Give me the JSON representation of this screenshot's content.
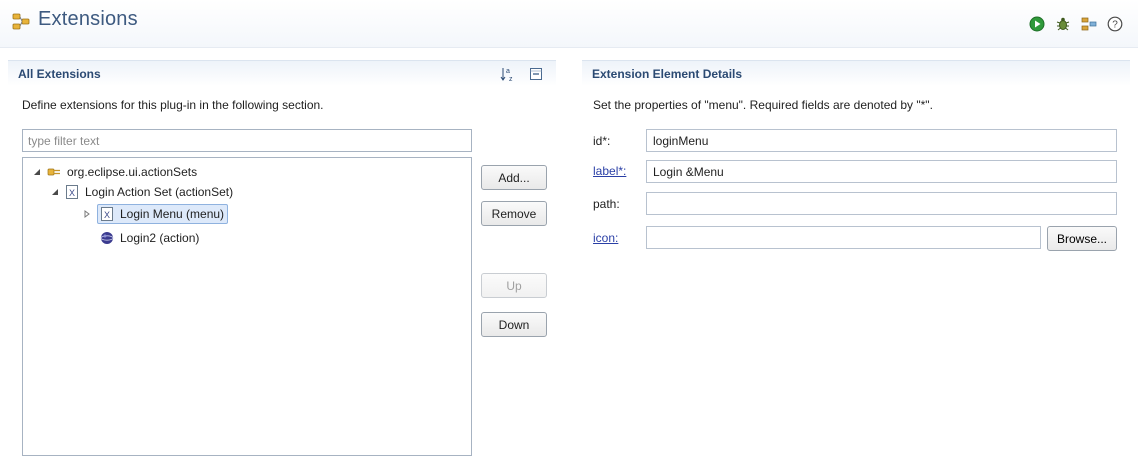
{
  "header": {
    "title": "Extensions",
    "actions": [
      "run-icon",
      "debug-icon",
      "plugin-icon",
      "help-icon"
    ]
  },
  "all_extensions": {
    "title": "All Extensions",
    "description": "Define extensions for this plug-in in the following section.",
    "filter_placeholder": "type filter text",
    "filter_value": "",
    "tools": [
      "sort-alphabetical-icon",
      "collapse-all-icon"
    ],
    "tree": [
      {
        "label": "org.eclipse.ui.actionSets",
        "icon": "extension-point-icon",
        "expanded": true
      },
      {
        "label": "Login Action Set (actionSet)",
        "icon": "xml-element-icon",
        "expanded": true
      },
      {
        "label": "Login Menu (menu)",
        "icon": "xml-element-icon",
        "expanded": false,
        "selected": true
      },
      {
        "label": "Login2 (action)",
        "icon": "action-icon"
      }
    ],
    "buttons": {
      "add": "Add...",
      "remove": "Remove",
      "up": "Up",
      "down": "Down"
    }
  },
  "details": {
    "title": "Extension Element Details",
    "description": "Set the properties of \"menu\". Required fields are denoted by \"*\".",
    "fields": {
      "id": {
        "label": "id*:",
        "value": "loginMenu"
      },
      "label": {
        "label": "label*:",
        "value": "Login &Menu"
      },
      "path": {
        "label": "path:",
        "value": ""
      },
      "icon": {
        "label": "icon:",
        "value": ""
      }
    },
    "browse": "Browse..."
  },
  "colors": {
    "title": "#3d5a80",
    "section_title": "#2b4a73",
    "link": "#2a3fa6",
    "selection": "#dde9fa"
  }
}
